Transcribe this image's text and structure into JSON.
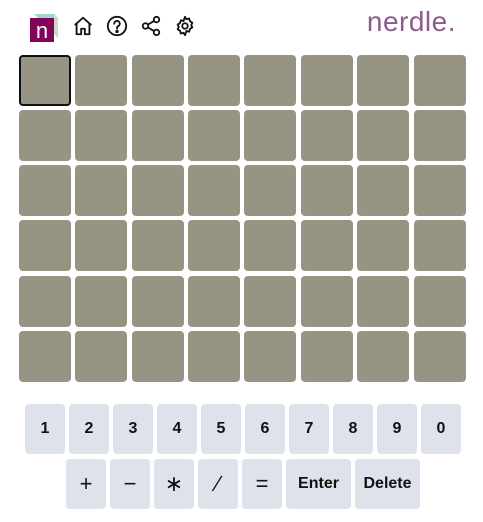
{
  "header": {
    "logo_letter": "n",
    "brand": "nerdle.",
    "icons": [
      "home-icon",
      "help-icon",
      "share-icon",
      "settings-icon"
    ]
  },
  "board": {
    "rows": 6,
    "cols": 8,
    "active_cell": [
      0,
      0
    ]
  },
  "keyboard": {
    "row1": [
      "1",
      "2",
      "3",
      "4",
      "5",
      "6",
      "7",
      "8",
      "9",
      "0"
    ],
    "row2": [
      "+",
      "−",
      "∗",
      "∕",
      "="
    ],
    "enter": "Enter",
    "delete": "Delete"
  },
  "colors": {
    "tile_empty": "#989484",
    "key_bg": "#dee2ea",
    "brand": "#8f5a8c",
    "logo_purple": "#820458",
    "logo_teal": "#9fd7d0"
  }
}
